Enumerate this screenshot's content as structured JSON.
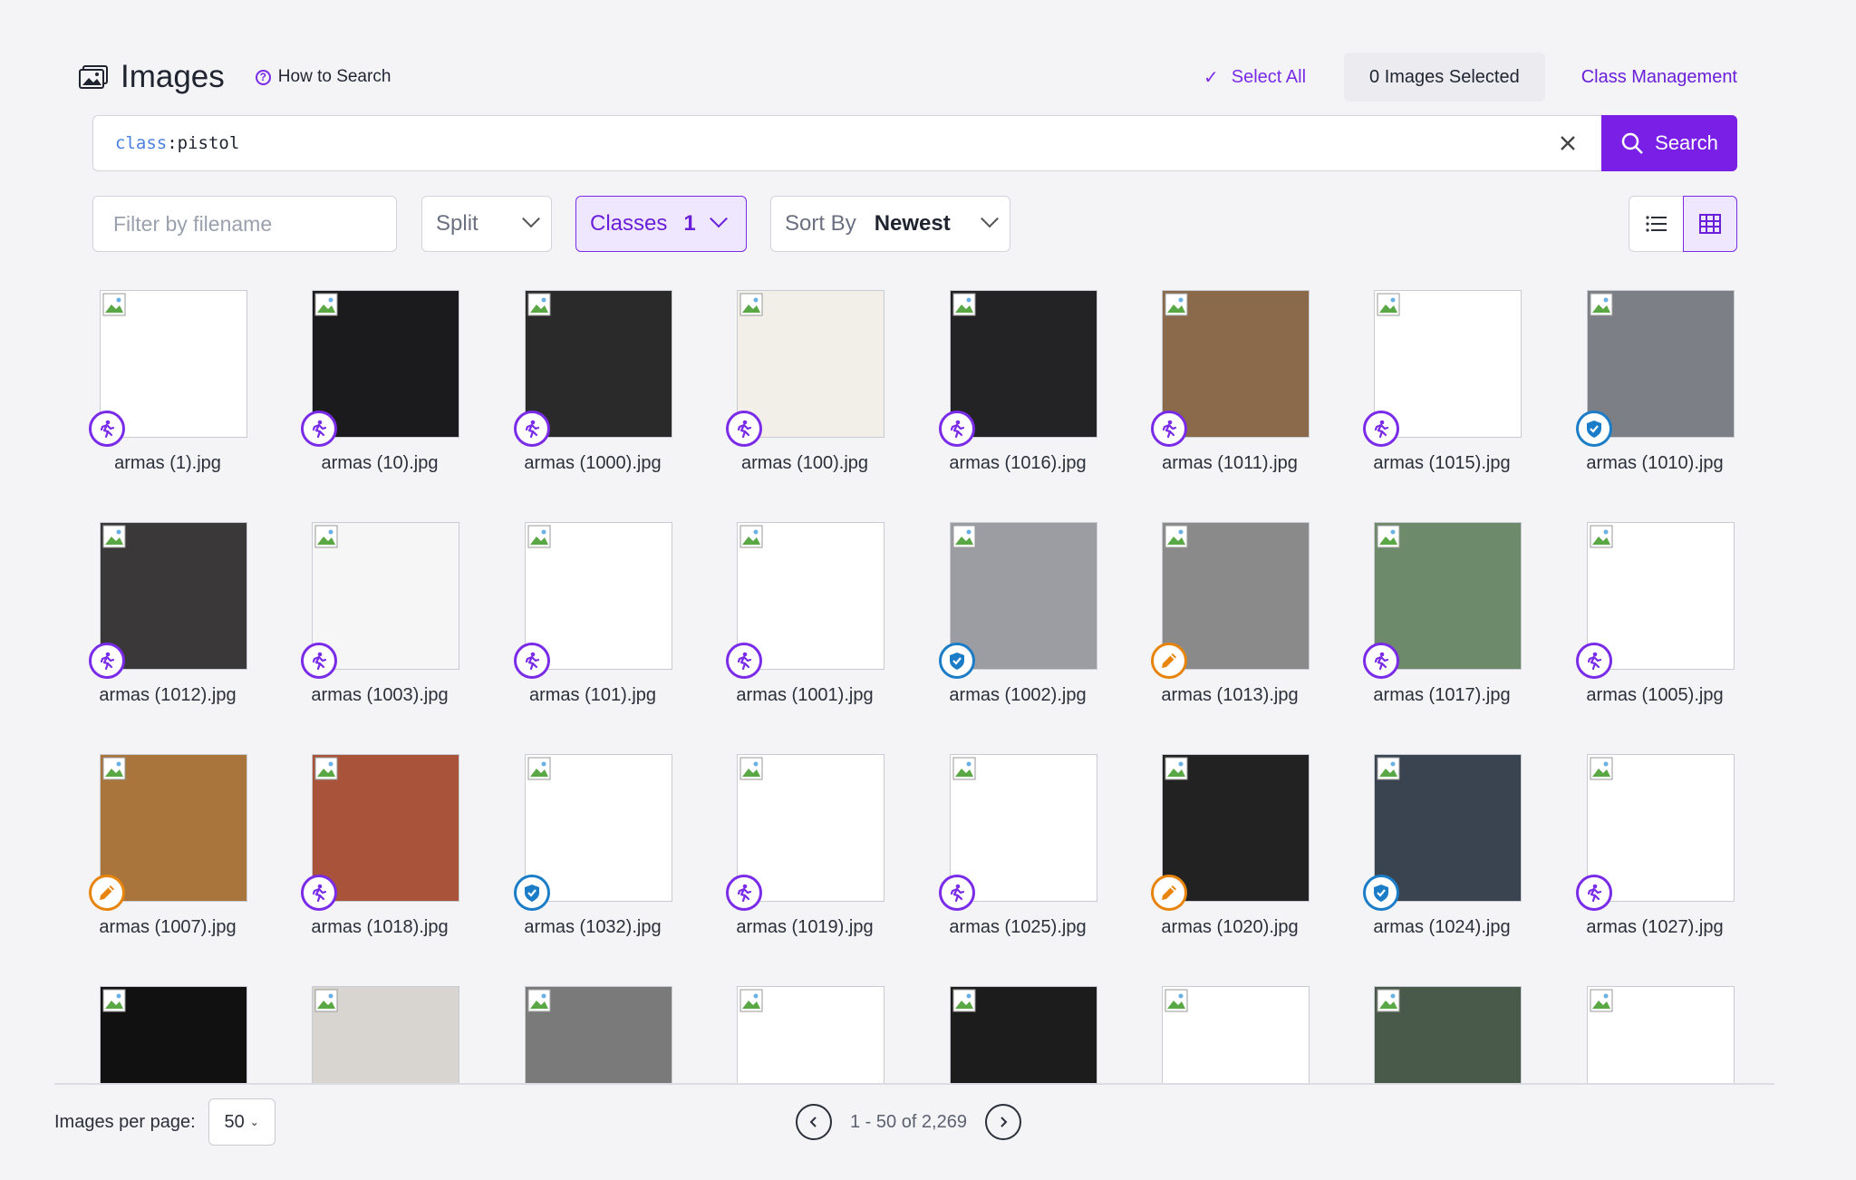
{
  "header": {
    "title": "Images",
    "help_label": "How to Search",
    "select_all_label": "Select All",
    "selected_count_label": "0 Images Selected",
    "class_management_label": "Class Management"
  },
  "search": {
    "keyword": "class",
    "separator": ":",
    "value": "pistol",
    "button_label": "Search"
  },
  "filters": {
    "filename_placeholder": "Filter by filename",
    "split_label": "Split",
    "classes_label": "Classes",
    "classes_count": "1",
    "sort_label": "Sort By",
    "sort_value": "Newest"
  },
  "images": [
    {
      "name": "armas (1).jpg",
      "badge": "person"
    },
    {
      "name": "armas (10).jpg",
      "badge": "person"
    },
    {
      "name": "armas (1000).jpg",
      "badge": "person"
    },
    {
      "name": "armas (100).jpg",
      "badge": "person"
    },
    {
      "name": "armas (1016).jpg",
      "badge": "person"
    },
    {
      "name": "armas (1011).jpg",
      "badge": "person"
    },
    {
      "name": "armas (1015).jpg",
      "badge": "person"
    },
    {
      "name": "armas (1010).jpg",
      "badge": "shield"
    },
    {
      "name": "armas (1012).jpg",
      "badge": "person"
    },
    {
      "name": "armas (1003).jpg",
      "badge": "person"
    },
    {
      "name": "armas (101).jpg",
      "badge": "person"
    },
    {
      "name": "armas (1001).jpg",
      "badge": "person"
    },
    {
      "name": "armas (1002).jpg",
      "badge": "shield"
    },
    {
      "name": "armas (1013).jpg",
      "badge": "pencil"
    },
    {
      "name": "armas (1017).jpg",
      "badge": "person"
    },
    {
      "name": "armas (1005).jpg",
      "badge": "person"
    },
    {
      "name": "armas (1007).jpg",
      "badge": "pencil"
    },
    {
      "name": "armas (1018).jpg",
      "badge": "person"
    },
    {
      "name": "armas (1032).jpg",
      "badge": "shield"
    },
    {
      "name": "armas (1019).jpg",
      "badge": "person"
    },
    {
      "name": "armas (1025).jpg",
      "badge": "person"
    },
    {
      "name": "armas (1020).jpg",
      "badge": "pencil"
    },
    {
      "name": "armas (1024).jpg",
      "badge": "shield"
    },
    {
      "name": "armas (1027).jpg",
      "badge": "person"
    },
    {
      "name": "",
      "badge": ""
    },
    {
      "name": "",
      "badge": ""
    },
    {
      "name": "",
      "badge": ""
    },
    {
      "name": "",
      "badge": ""
    },
    {
      "name": "",
      "badge": ""
    },
    {
      "name": "",
      "badge": ""
    },
    {
      "name": "",
      "badge": ""
    },
    {
      "name": "",
      "badge": ""
    }
  ],
  "pagination": {
    "per_page_label": "Images per page:",
    "per_page_value": "50",
    "range_label": "1 - 50 of 2,269"
  },
  "colors": {
    "accent": "#7a1fe6",
    "badge_person": "#7a2be8",
    "badge_shield": "#1b7dc7",
    "badge_pencil": "#e7840c"
  }
}
